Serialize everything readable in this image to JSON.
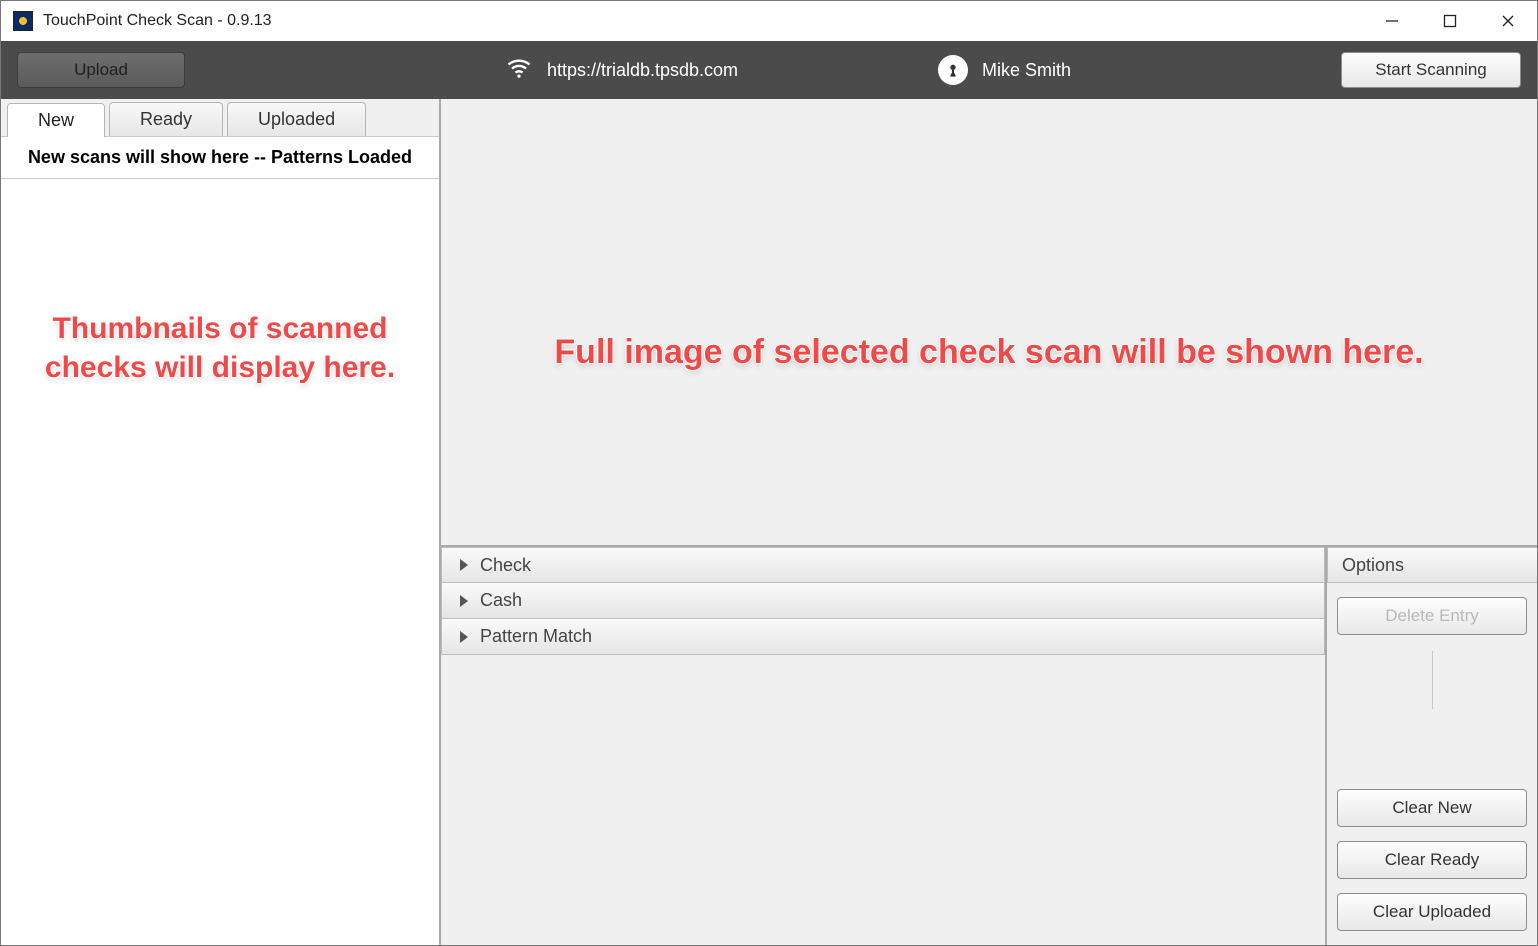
{
  "window": {
    "title": "TouchPoint Check Scan - 0.9.13"
  },
  "toolbar": {
    "upload_label": "Upload",
    "start_scan_label": "Start Scanning",
    "url": "https://trialdb.tpsdb.com",
    "username": "Mike Smith"
  },
  "tabs": {
    "new": "New",
    "ready": "Ready",
    "uploaded": "Uploaded"
  },
  "status_text": "New scans will show here -- Patterns Loaded",
  "annotations": {
    "thumbs": "Thumbnails of scanned checks will display here.",
    "preview": "Full image of selected check scan will be shown here."
  },
  "accordion": {
    "check": "Check",
    "cash": "Cash",
    "pattern_match": "Pattern Match"
  },
  "options": {
    "header": "Options",
    "delete_entry": "Delete Entry",
    "clear_new": "Clear New",
    "clear_ready": "Clear Ready",
    "clear_uploaded": "Clear Uploaded"
  }
}
